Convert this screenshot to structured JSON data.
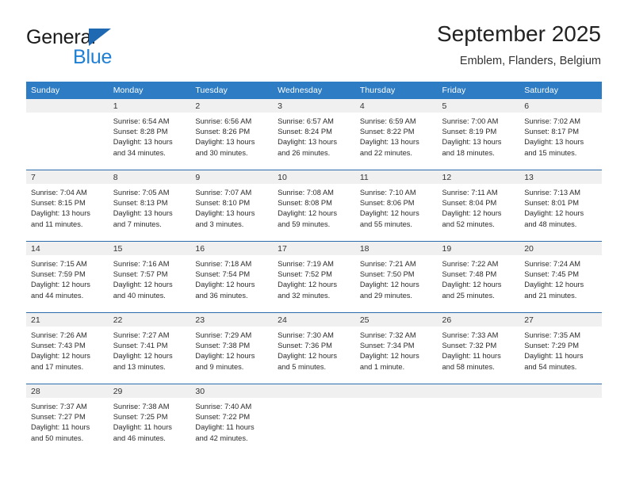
{
  "brand": {
    "name_top": "General",
    "name_bottom": "Blue",
    "triangle_color": "#1f69b3",
    "blue_color": "#1f7fd4"
  },
  "header": {
    "title": "September 2025",
    "location": "Emblem, Flanders, Belgium"
  },
  "theme": {
    "header_bg": "#2d7cc4",
    "header_text": "#ffffff",
    "row_divider": "#2b6cad",
    "daynum_bg": "#f0f0f0"
  },
  "weekdays": [
    "Sunday",
    "Monday",
    "Tuesday",
    "Wednesday",
    "Thursday",
    "Friday",
    "Saturday"
  ],
  "weeks": [
    [
      {
        "day": "",
        "sunrise": "",
        "sunset": "",
        "daylight1": "",
        "daylight2": ""
      },
      {
        "day": "1",
        "sunrise": "Sunrise: 6:54 AM",
        "sunset": "Sunset: 8:28 PM",
        "daylight1": "Daylight: 13 hours",
        "daylight2": "and 34 minutes."
      },
      {
        "day": "2",
        "sunrise": "Sunrise: 6:56 AM",
        "sunset": "Sunset: 8:26 PM",
        "daylight1": "Daylight: 13 hours",
        "daylight2": "and 30 minutes."
      },
      {
        "day": "3",
        "sunrise": "Sunrise: 6:57 AM",
        "sunset": "Sunset: 8:24 PM",
        "daylight1": "Daylight: 13 hours",
        "daylight2": "and 26 minutes."
      },
      {
        "day": "4",
        "sunrise": "Sunrise: 6:59 AM",
        "sunset": "Sunset: 8:22 PM",
        "daylight1": "Daylight: 13 hours",
        "daylight2": "and 22 minutes."
      },
      {
        "day": "5",
        "sunrise": "Sunrise: 7:00 AM",
        "sunset": "Sunset: 8:19 PM",
        "daylight1": "Daylight: 13 hours",
        "daylight2": "and 18 minutes."
      },
      {
        "day": "6",
        "sunrise": "Sunrise: 7:02 AM",
        "sunset": "Sunset: 8:17 PM",
        "daylight1": "Daylight: 13 hours",
        "daylight2": "and 15 minutes."
      }
    ],
    [
      {
        "day": "7",
        "sunrise": "Sunrise: 7:04 AM",
        "sunset": "Sunset: 8:15 PM",
        "daylight1": "Daylight: 13 hours",
        "daylight2": "and 11 minutes."
      },
      {
        "day": "8",
        "sunrise": "Sunrise: 7:05 AM",
        "sunset": "Sunset: 8:13 PM",
        "daylight1": "Daylight: 13 hours",
        "daylight2": "and 7 minutes."
      },
      {
        "day": "9",
        "sunrise": "Sunrise: 7:07 AM",
        "sunset": "Sunset: 8:10 PM",
        "daylight1": "Daylight: 13 hours",
        "daylight2": "and 3 minutes."
      },
      {
        "day": "10",
        "sunrise": "Sunrise: 7:08 AM",
        "sunset": "Sunset: 8:08 PM",
        "daylight1": "Daylight: 12 hours",
        "daylight2": "and 59 minutes."
      },
      {
        "day": "11",
        "sunrise": "Sunrise: 7:10 AM",
        "sunset": "Sunset: 8:06 PM",
        "daylight1": "Daylight: 12 hours",
        "daylight2": "and 55 minutes."
      },
      {
        "day": "12",
        "sunrise": "Sunrise: 7:11 AM",
        "sunset": "Sunset: 8:04 PM",
        "daylight1": "Daylight: 12 hours",
        "daylight2": "and 52 minutes."
      },
      {
        "day": "13",
        "sunrise": "Sunrise: 7:13 AM",
        "sunset": "Sunset: 8:01 PM",
        "daylight1": "Daylight: 12 hours",
        "daylight2": "and 48 minutes."
      }
    ],
    [
      {
        "day": "14",
        "sunrise": "Sunrise: 7:15 AM",
        "sunset": "Sunset: 7:59 PM",
        "daylight1": "Daylight: 12 hours",
        "daylight2": "and 44 minutes."
      },
      {
        "day": "15",
        "sunrise": "Sunrise: 7:16 AM",
        "sunset": "Sunset: 7:57 PM",
        "daylight1": "Daylight: 12 hours",
        "daylight2": "and 40 minutes."
      },
      {
        "day": "16",
        "sunrise": "Sunrise: 7:18 AM",
        "sunset": "Sunset: 7:54 PM",
        "daylight1": "Daylight: 12 hours",
        "daylight2": "and 36 minutes."
      },
      {
        "day": "17",
        "sunrise": "Sunrise: 7:19 AM",
        "sunset": "Sunset: 7:52 PM",
        "daylight1": "Daylight: 12 hours",
        "daylight2": "and 32 minutes."
      },
      {
        "day": "18",
        "sunrise": "Sunrise: 7:21 AM",
        "sunset": "Sunset: 7:50 PM",
        "daylight1": "Daylight: 12 hours",
        "daylight2": "and 29 minutes."
      },
      {
        "day": "19",
        "sunrise": "Sunrise: 7:22 AM",
        "sunset": "Sunset: 7:48 PM",
        "daylight1": "Daylight: 12 hours",
        "daylight2": "and 25 minutes."
      },
      {
        "day": "20",
        "sunrise": "Sunrise: 7:24 AM",
        "sunset": "Sunset: 7:45 PM",
        "daylight1": "Daylight: 12 hours",
        "daylight2": "and 21 minutes."
      }
    ],
    [
      {
        "day": "21",
        "sunrise": "Sunrise: 7:26 AM",
        "sunset": "Sunset: 7:43 PM",
        "daylight1": "Daylight: 12 hours",
        "daylight2": "and 17 minutes."
      },
      {
        "day": "22",
        "sunrise": "Sunrise: 7:27 AM",
        "sunset": "Sunset: 7:41 PM",
        "daylight1": "Daylight: 12 hours",
        "daylight2": "and 13 minutes."
      },
      {
        "day": "23",
        "sunrise": "Sunrise: 7:29 AM",
        "sunset": "Sunset: 7:38 PM",
        "daylight1": "Daylight: 12 hours",
        "daylight2": "and 9 minutes."
      },
      {
        "day": "24",
        "sunrise": "Sunrise: 7:30 AM",
        "sunset": "Sunset: 7:36 PM",
        "daylight1": "Daylight: 12 hours",
        "daylight2": "and 5 minutes."
      },
      {
        "day": "25",
        "sunrise": "Sunrise: 7:32 AM",
        "sunset": "Sunset: 7:34 PM",
        "daylight1": "Daylight: 12 hours",
        "daylight2": "and 1 minute."
      },
      {
        "day": "26",
        "sunrise": "Sunrise: 7:33 AM",
        "sunset": "Sunset: 7:32 PM",
        "daylight1": "Daylight: 11 hours",
        "daylight2": "and 58 minutes."
      },
      {
        "day": "27",
        "sunrise": "Sunrise: 7:35 AM",
        "sunset": "Sunset: 7:29 PM",
        "daylight1": "Daylight: 11 hours",
        "daylight2": "and 54 minutes."
      }
    ],
    [
      {
        "day": "28",
        "sunrise": "Sunrise: 7:37 AM",
        "sunset": "Sunset: 7:27 PM",
        "daylight1": "Daylight: 11 hours",
        "daylight2": "and 50 minutes."
      },
      {
        "day": "29",
        "sunrise": "Sunrise: 7:38 AM",
        "sunset": "Sunset: 7:25 PM",
        "daylight1": "Daylight: 11 hours",
        "daylight2": "and 46 minutes."
      },
      {
        "day": "30",
        "sunrise": "Sunrise: 7:40 AM",
        "sunset": "Sunset: 7:22 PM",
        "daylight1": "Daylight: 11 hours",
        "daylight2": "and 42 minutes."
      },
      {
        "day": "",
        "sunrise": "",
        "sunset": "",
        "daylight1": "",
        "daylight2": ""
      },
      {
        "day": "",
        "sunrise": "",
        "sunset": "",
        "daylight1": "",
        "daylight2": ""
      },
      {
        "day": "",
        "sunrise": "",
        "sunset": "",
        "daylight1": "",
        "daylight2": ""
      },
      {
        "day": "",
        "sunrise": "",
        "sunset": "",
        "daylight1": "",
        "daylight2": ""
      }
    ]
  ]
}
